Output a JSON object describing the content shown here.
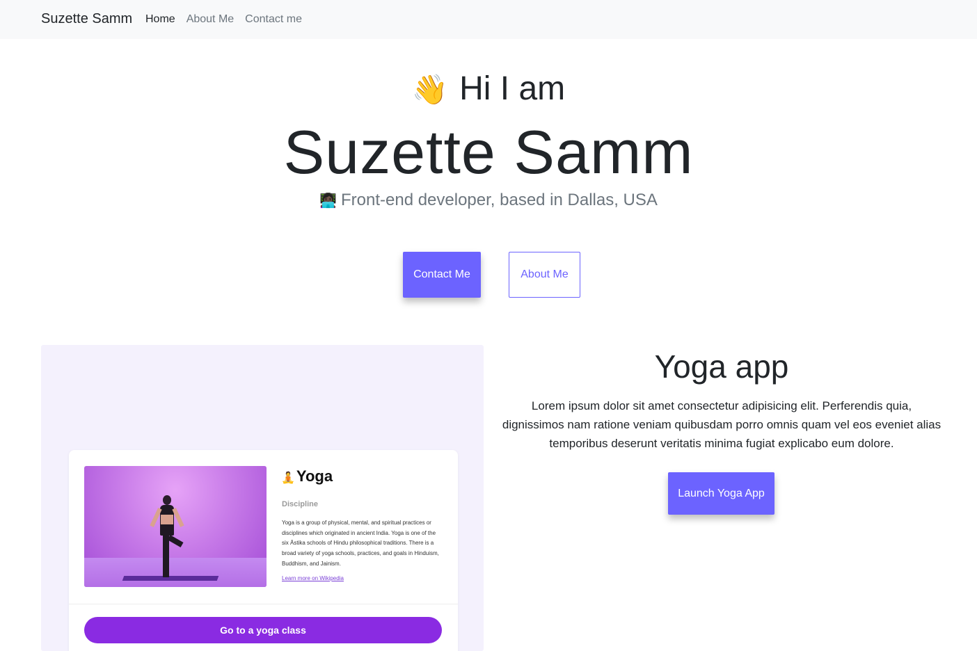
{
  "navbar": {
    "brand": "Suzette Samm",
    "links": [
      {
        "label": "Home",
        "active": true
      },
      {
        "label": "About Me",
        "active": false
      },
      {
        "label": "Contact me",
        "active": false
      }
    ]
  },
  "hero": {
    "wave_emoji": "👋",
    "greeting": "Hi I am",
    "name": "Suzette Samm",
    "subtitle_emoji": "👩🏿‍💻",
    "subtitle": "Front-end developer, based in Dallas, USA",
    "contact_button": "Contact Me",
    "about_button": "About Me"
  },
  "project": {
    "title": "Yoga app",
    "description": "Lorem ipsum dolor sit amet consectetur adipisicing elit. Perferendis quia, dignissimos nam ratione veniam quibusdam porro omnis quam vel eos eveniet alias temporibus deserunt veritatis minima fugiat explicabo eum dolore.",
    "launch_button": "Launch Yoga App",
    "preview": {
      "emoji": "🧘",
      "title": "Yoga",
      "label": "Discipline",
      "text": "Yoga is a group of physical, mental, and spiritual practices or disciplines which originated in ancient India. Yoga is one of the six Āstika schools of Hindu philosophical traditions. There is a broad variety of yoga schools, practices, and goals in Hinduism, Buddhism, and Jainism.",
      "link": "Learn more on Wikipedia",
      "cta": "Go to a yoga class"
    }
  },
  "colors": {
    "accent": "#6c63ff",
    "preview_bg": "#f4f1fd",
    "cta_purple": "#8a2be2",
    "navbar_bg": "#f8f9fa"
  }
}
